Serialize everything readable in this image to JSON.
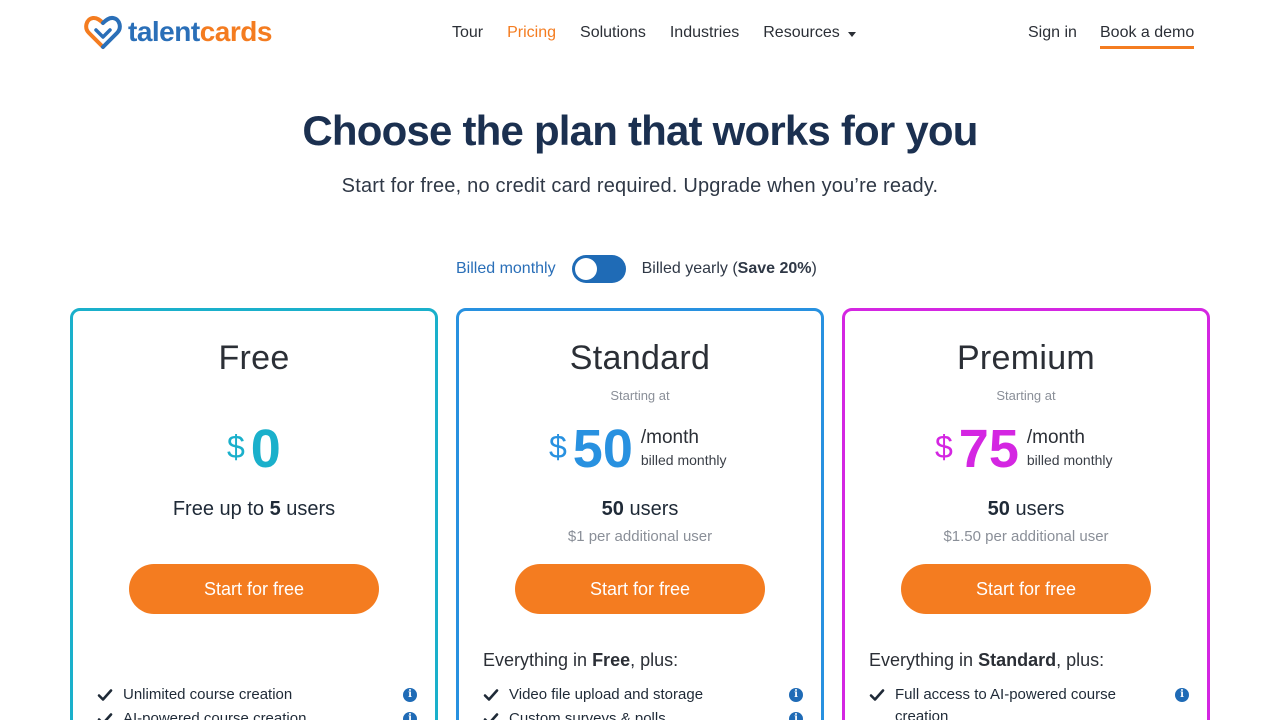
{
  "brand": {
    "talent": "talent",
    "cards": "cards",
    "accent": "#f47c20",
    "primary": "#2a6fb8"
  },
  "nav": {
    "tour": "Tour",
    "pricing": "Pricing",
    "solutions": "Solutions",
    "industries": "Industries",
    "resources": "Resources",
    "active": "Pricing"
  },
  "header": {
    "sign_in": "Sign in",
    "book_demo": "Book a demo"
  },
  "hero": {
    "title": "Choose the plan that works for you",
    "subtitle": "Start for free, no credit card required. Upgrade when you’re ready."
  },
  "billing": {
    "monthly": "Billed monthly",
    "yearly": "Billed yearly (",
    "save": "Save 20%",
    "yearly_close": ")",
    "selected": "monthly"
  },
  "plans": {
    "free": {
      "name": "Free",
      "currency": "$",
      "price": "0",
      "users_prefix": "Free up to ",
      "users_count": "5",
      "users_suffix": " users",
      "cta": "Start for free",
      "color": "#1ab0cb",
      "features": [
        {
          "text": "Unlimited course creation"
        },
        {
          "text": "AI-powered course creation"
        }
      ]
    },
    "standard": {
      "name": "Standard",
      "starting": "Starting at",
      "currency": "$",
      "price": "50",
      "per": "/month",
      "billed": "billed monthly",
      "users_count": "50",
      "users_suffix": " users",
      "additional": "$1 per additional user",
      "cta": "Start for free",
      "plus_prefix": "Everything in ",
      "plus_plan": "Free",
      "plus_suffix": ", plus:",
      "color": "#2891e0",
      "features": [
        {
          "text": "Video file upload and storage"
        },
        {
          "text": "Custom surveys & polls"
        }
      ]
    },
    "premium": {
      "name": "Premium",
      "starting": "Starting at",
      "currency": "$",
      "price": "75",
      "per": "/month",
      "billed": "billed monthly",
      "users_count": "50",
      "users_suffix": " users",
      "additional": "$1.50 per additional user",
      "cta": "Start for free",
      "plus_prefix": "Everything in ",
      "plus_plan": "Standard",
      "plus_suffix": ", plus:",
      "color": "#d426e2",
      "features": [
        {
          "text": "Full access to AI-powered course creation"
        }
      ]
    }
  },
  "icons": {
    "check": "check-icon",
    "info": "info-icon",
    "logo": "heart-logo-icon",
    "caret": "caret-down-icon"
  },
  "info_glyph": "i"
}
